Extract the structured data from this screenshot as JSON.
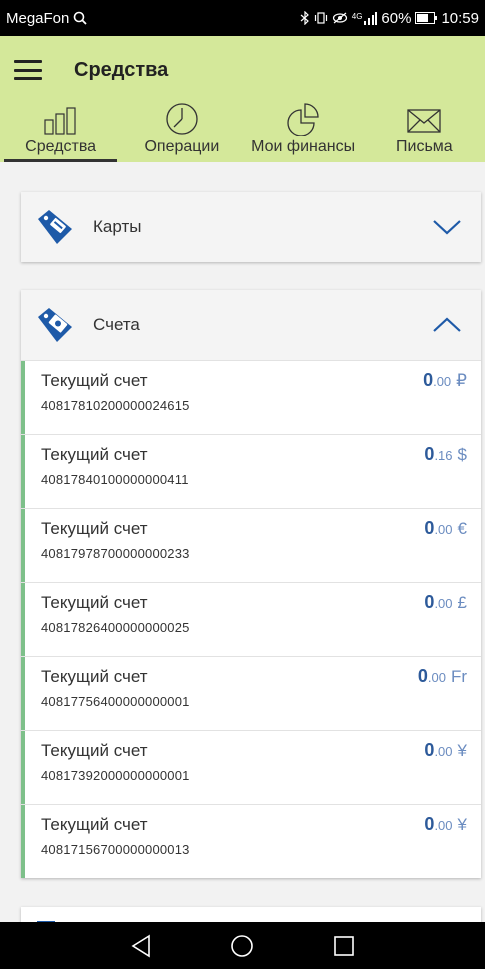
{
  "status_bar": {
    "carrier": "MegaFon",
    "network": "4G",
    "battery": "60%",
    "time": "10:59"
  },
  "header": {
    "title": "Средства",
    "background": "#d4e89a"
  },
  "tabs": [
    {
      "label": "Средства",
      "icon": "bar-chart-icon",
      "active": true
    },
    {
      "label": "Операции",
      "icon": "clock-icon",
      "active": false
    },
    {
      "label": "Мои финансы",
      "icon": "pie-chart-icon",
      "active": false
    },
    {
      "label": "Письма",
      "icon": "envelope-icon",
      "active": false
    }
  ],
  "sections": {
    "cards": {
      "title": "Карты",
      "icon": "card-tag-icon",
      "expanded": false
    },
    "accounts": {
      "title": "Счета",
      "icon": "money-tag-icon",
      "expanded": true,
      "items": [
        {
          "name": "Текущий счет",
          "number": "40817810200000024615",
          "int": "0",
          "dec": ".00",
          "currency": "₽"
        },
        {
          "name": "Текущий счет",
          "number": "40817840100000000411",
          "int": "0",
          "dec": ".16",
          "currency": "$"
        },
        {
          "name": "Текущий счет",
          "number": "40817978700000000233",
          "int": "0",
          "dec": ".00",
          "currency": "€"
        },
        {
          "name": "Текущий счет",
          "number": "40817826400000000025",
          "int": "0",
          "dec": ".00",
          "currency": "£"
        },
        {
          "name": "Текущий счет",
          "number": "40817756400000000001",
          "int": "0",
          "dec": ".00",
          "currency": "Fr"
        },
        {
          "name": "Текущий счет",
          "number": "40817392000000000001",
          "int": "0",
          "dec": ".00",
          "currency": "¥"
        },
        {
          "name": "Текущий счет",
          "number": "40817156700000000013",
          "int": "0",
          "dec": ".00",
          "currency": "¥"
        }
      ]
    }
  },
  "colors": {
    "accent_green": "#7ec08a",
    "balance_blue": "#2d5a9a",
    "icon_blue": "#1e5aa8"
  }
}
